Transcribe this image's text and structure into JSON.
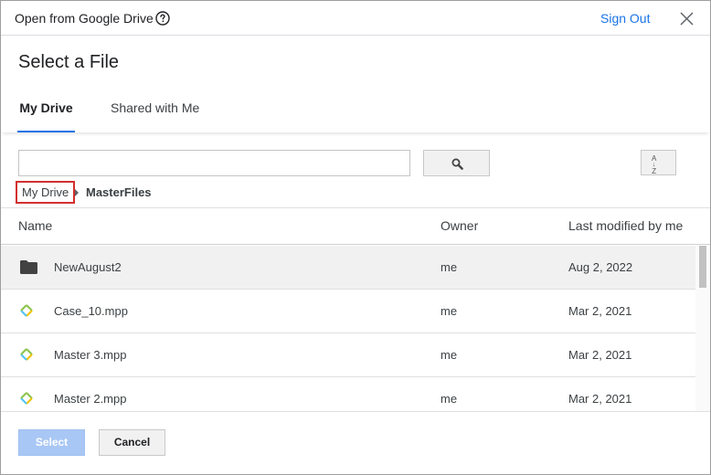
{
  "titlebar": {
    "title": "Open from Google Drive",
    "help_icon": "help-circle-icon",
    "sign_out_label": "Sign Out",
    "close_icon": "close-icon"
  },
  "heading": "Select a File",
  "tabs": [
    {
      "label": "My Drive",
      "active": true
    },
    {
      "label": "Shared with Me",
      "active": false
    }
  ],
  "search": {
    "value": "",
    "placeholder": "",
    "icon": "search-icon"
  },
  "sort": {
    "label_top": "A",
    "label_bottom": "Z",
    "icon": "sort-az-icon"
  },
  "breadcrumb": {
    "root": "My Drive",
    "separator_icon": "caret-right-icon",
    "current": "MasterFiles"
  },
  "table": {
    "columns": {
      "name": "Name",
      "owner": "Owner",
      "modified": "Last modified by me"
    },
    "rows": [
      {
        "icon": "folder-icon",
        "name": "NewAugust2",
        "owner": "me",
        "modified": "Aug 2, 2022",
        "selected": true
      },
      {
        "icon": "project-file-icon",
        "name": "Case_10.mpp",
        "owner": "me",
        "modified": "Mar 2, 2021",
        "selected": false
      },
      {
        "icon": "project-file-icon",
        "name": "Master 3.mpp",
        "owner": "me",
        "modified": "Mar 2, 2021",
        "selected": false
      },
      {
        "icon": "project-file-icon",
        "name": "Master 2.mpp",
        "owner": "me",
        "modified": "Mar 2, 2021",
        "selected": false
      }
    ]
  },
  "footer": {
    "select_label": "Select",
    "cancel_label": "Cancel"
  },
  "colors": {
    "accent": "#1a73e8",
    "select_disabled": "#a9c7f5",
    "breadcrumb_highlight": "#d32f2f",
    "file_icon_green": "#8bc34a",
    "file_icon_yellow": "#f2c200",
    "file_icon_blue": "#4fc3f7"
  }
}
